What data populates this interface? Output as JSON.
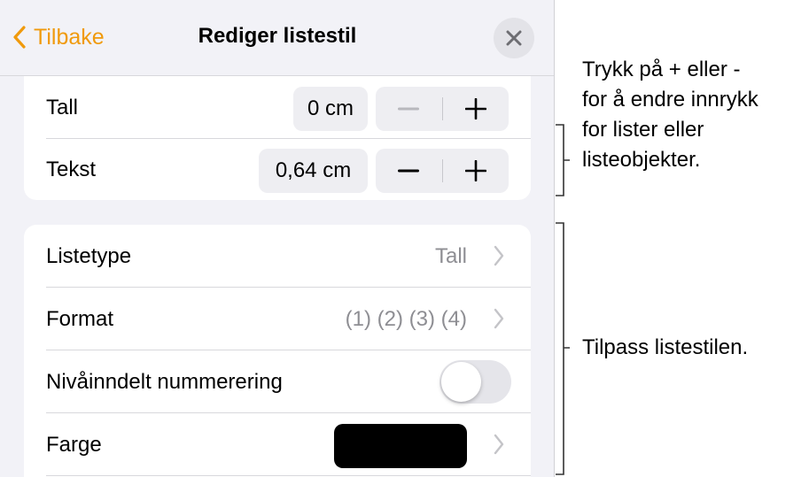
{
  "navbar": {
    "back_label": "Tilbake",
    "title": "Rediger listestil"
  },
  "indent": {
    "rows": [
      {
        "label": "Tall",
        "value": "0 cm",
        "minus": "−",
        "plus": "+"
      },
      {
        "label": "Tekst",
        "value": "0,64 cm",
        "minus": "−",
        "plus": "+"
      }
    ]
  },
  "style": {
    "list_type": {
      "label": "Listetype",
      "value": "Tall"
    },
    "format": {
      "label": "Format",
      "value": "(1) (2) (3) (4)"
    },
    "tiered": {
      "label": "Nivåinndelt nummerering",
      "on": false
    },
    "color": {
      "label": "Farge",
      "swatch": "#000000"
    }
  },
  "callouts": {
    "indent_lines": [
      "Trykk på + eller -",
      "for å endre innrykk",
      "for lister eller",
      "listeobjekter."
    ],
    "style_line": "Tilpass listestilen."
  },
  "colors": {
    "accent": "#f09a0c",
    "background": "#f2f2f7",
    "secondary_text": "#8e8e93",
    "toggle_off": "#e5e5ea"
  }
}
